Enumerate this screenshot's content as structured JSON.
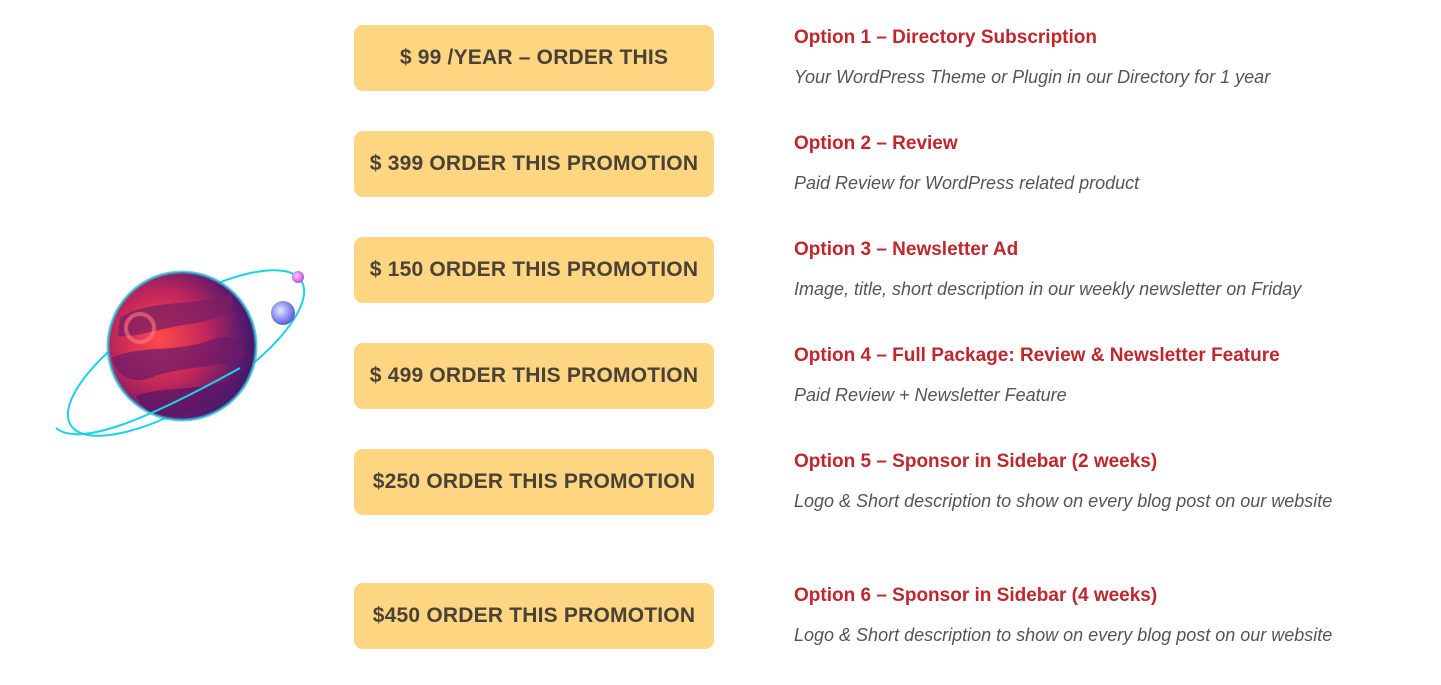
{
  "colors": {
    "button_bg": "#fed581",
    "button_text": "#4a4236",
    "title_red": "#c0272d",
    "desc_gray": "#555555",
    "orbit_cyan": "#19d3e8"
  },
  "illustration": {
    "icon": "planet-with-orbit-icon"
  },
  "options": [
    {
      "button_label": "$ 99 /YEAR – ORDER THIS",
      "title": "Option 1 – Directory Subscription",
      "description": "Your WordPress Theme or Plugin in our Directory for 1 year"
    },
    {
      "button_label": "$ 399 ORDER THIS PROMOTION",
      "title": "Option 2 – Review",
      "description": "Paid Review for WordPress related product"
    },
    {
      "button_label": "$ 150 ORDER THIS PROMOTION",
      "title": "Option 3 – Newsletter Ad",
      "description": "Image, title, short description in our weekly newsletter on Friday"
    },
    {
      "button_label": "$ 499 ORDER THIS PROMOTION",
      "title": "Option 4 – Full Package: Review & Newsletter Feature",
      "description": "Paid Review + Newsletter Feature"
    },
    {
      "button_label": "$250 ORDER THIS PROMOTION",
      "title": "Option 5 – Sponsor in Sidebar (2 weeks)",
      "description": "Logo & Short description to show on every blog post on our website"
    },
    {
      "button_label": "$450 ORDER THIS PROMOTION",
      "title": "Option 6 – Sponsor in Sidebar (4 weeks)",
      "description": "Logo & Short description to show on every blog post on our website"
    }
  ]
}
